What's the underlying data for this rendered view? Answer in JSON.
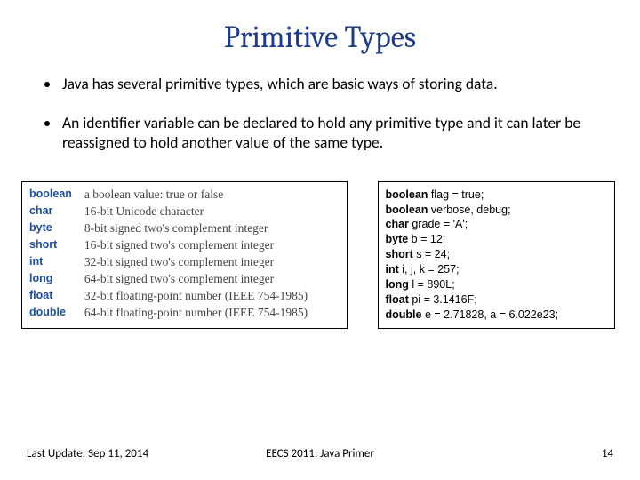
{
  "title": "Primitive Types",
  "bullets": [
    "Java has several primitive types, which are basic ways of storing data.",
    "An identifier variable can be declared to hold any primitive type and it can later be reassigned to hold another value of the same type."
  ],
  "types_table": [
    {
      "kw": "boolean",
      "desc": "a boolean value: true or false"
    },
    {
      "kw": "char",
      "desc": "16-bit Unicode character"
    },
    {
      "kw": "byte",
      "desc": "8-bit signed two's complement integer"
    },
    {
      "kw": "short",
      "desc": "16-bit signed two's complement integer"
    },
    {
      "kw": "int",
      "desc": "32-bit signed two's complement integer"
    },
    {
      "kw": "long",
      "desc": "64-bit signed two's complement integer"
    },
    {
      "kw": "float",
      "desc": "32-bit floating-point number (IEEE 754-1985)"
    },
    {
      "kw": "double",
      "desc": "64-bit floating-point number (IEEE 754-1985)"
    }
  ],
  "code_lines": [
    {
      "kw": "boolean",
      "rest": " flag = true;"
    },
    {
      "kw": "boolean",
      "rest": " verbose, debug;"
    },
    {
      "kw": "char",
      "rest": " grade = 'A';"
    },
    {
      "kw": "byte",
      "rest": " b = 12;"
    },
    {
      "kw": "short",
      "rest": " s = 24;"
    },
    {
      "kw": "int",
      "rest": " i, j, k = 257;"
    },
    {
      "kw": "long",
      "rest": " l = 890L;"
    },
    {
      "kw": "float",
      "rest": " pi = 3.1416F;"
    },
    {
      "kw": "double",
      "rest": " e = 2.71828, a = 6.022e23;"
    }
  ],
  "footer": {
    "left": "Last Update: Sep 11, 2014",
    "center": "EECS 2011: Java Primer",
    "right": "14"
  }
}
